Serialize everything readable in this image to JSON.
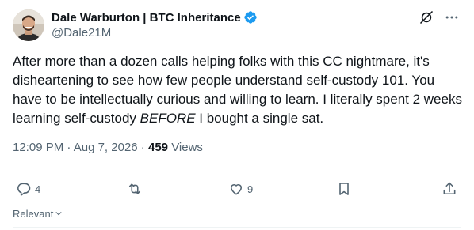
{
  "author": {
    "display_name": "Dale Warburton | BTC Inheritance",
    "handle": "@Dale21M",
    "verified": true,
    "avatar_icon": "profile-photo"
  },
  "tweet": {
    "text_before": "After more than a dozen calls helping folks with this CC nightmare, it's disheartening to see how few people understand self-custody 101. You have to be intellectually curious and willing to learn. I literally spent 2 weeks learning self-custody ",
    "text_emphasis": "BEFORE",
    "text_after": " I bought a single sat."
  },
  "meta": {
    "time": "12:09 PM",
    "separator": " · ",
    "date": "Aug 7, 2026",
    "views_count": "459",
    "views_label": "Views"
  },
  "actions": {
    "replies": "4",
    "retweets": "",
    "likes": "9",
    "bookmark_icon": "bookmark-icon",
    "share_icon": "share-icon"
  },
  "replies_sort": {
    "label": "Relevant"
  },
  "colors": {
    "text_primary": "#0f1419",
    "text_secondary": "#536471",
    "verified_blue": "#1d9bf0",
    "divider": "#eff3f4"
  }
}
